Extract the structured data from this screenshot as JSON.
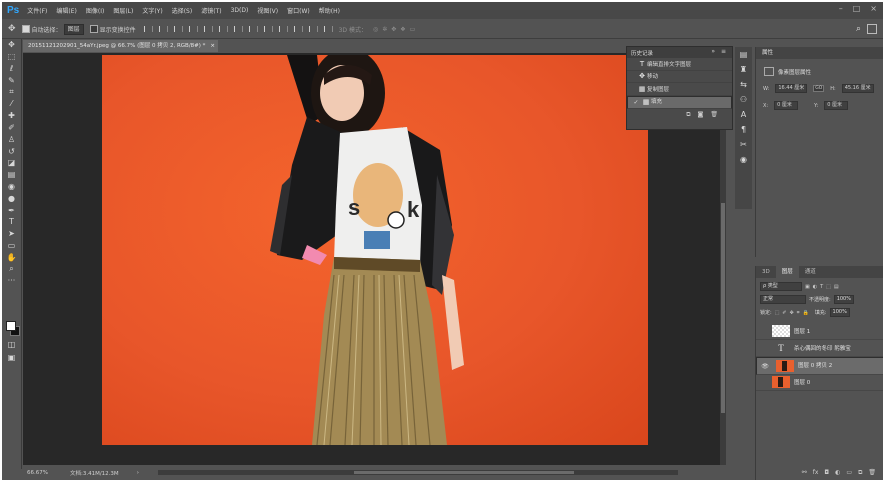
{
  "app": {
    "logo": "Ps"
  },
  "menu": [
    "文件(F)",
    "编辑(E)",
    "图像(I)",
    "图层(L)",
    "文字(Y)",
    "选择(S)",
    "滤镜(T)",
    "3D(D)",
    "视图(V)",
    "窗口(W)",
    "帮助(H)"
  ],
  "window_controls": [
    "–",
    "□",
    "×"
  ],
  "options": {
    "auto_select_label": "自动选择：",
    "auto_select_value": "图层",
    "show_transform_label": "显示变换控件",
    "mode_3d_label": "3D 模式："
  },
  "document": {
    "tab_title": "201511212029​01_54aYr.jpeg @ 66.7% (图层 0 拷贝 2, RGB/8#) *",
    "close": "×"
  },
  "status": {
    "zoom": "66.67%",
    "doc_size": "文档:3.41M/12.3M",
    "arrow": "›"
  },
  "history": {
    "title": "历史记录",
    "items": [
      {
        "icon": "T",
        "label": "编辑直排文字图层",
        "selected": false,
        "marked": false
      },
      {
        "icon": "✥",
        "label": "移动",
        "selected": false,
        "marked": false
      },
      {
        "icon": "▦",
        "label": "复制图层",
        "selected": false,
        "marked": false
      },
      {
        "icon": "▦",
        "label": "填充",
        "selected": true,
        "marked": true
      }
    ]
  },
  "properties": {
    "tab": "属性",
    "title": "像素图层属性",
    "w_label": "W:",
    "w_value": "16.44 厘米",
    "link": "GO",
    "h_label": "H:",
    "h_value": "45.16 厘米",
    "x_label": "X:",
    "x_value": "0 厘米",
    "y_label": "Y:",
    "y_value": "0 厘米"
  },
  "layers": {
    "tabs": [
      "3D",
      "图层",
      "通道"
    ],
    "active_tab": 1,
    "filter": "ρ 类型",
    "blend_mode": "正常",
    "opacity_label": "不透明度:",
    "opacity_value": "100%",
    "lock_label": "锁定:",
    "fill_label": "填充:",
    "fill_value": "100%",
    "items": [
      {
        "name": "图层 1",
        "thumb": "transparent",
        "visible": false,
        "selected": false
      },
      {
        "name": "杀心偶回的冬印 躬雅宝",
        "thumb": "text",
        "visible": false,
        "selected": false
      },
      {
        "name": "图层 0 拷贝 2",
        "thumb": "photo",
        "visible": true,
        "selected": true
      },
      {
        "name": "图层 0",
        "thumb": "photo",
        "visible": false,
        "selected": false
      }
    ]
  }
}
